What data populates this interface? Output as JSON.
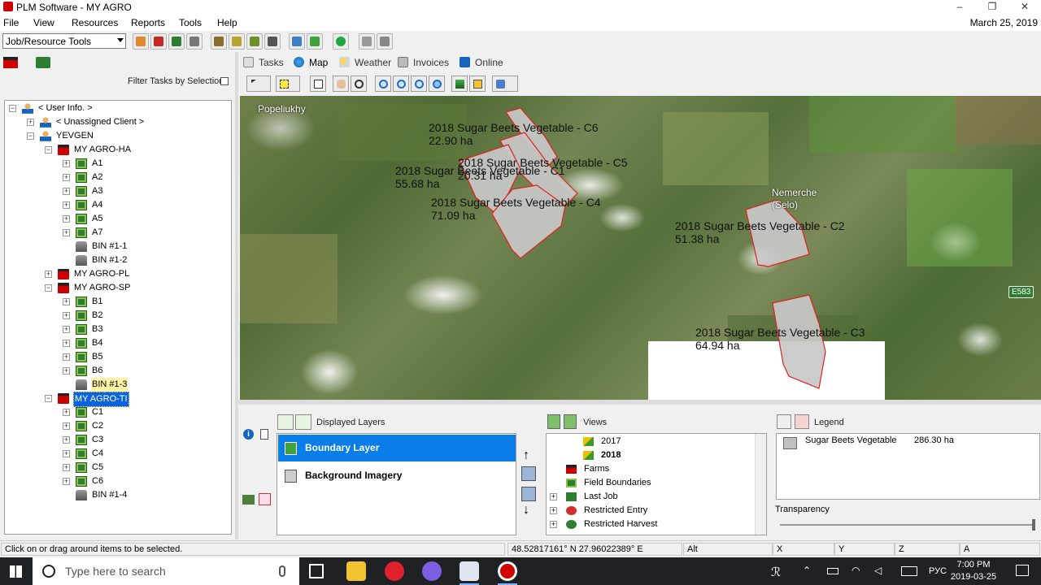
{
  "window": {
    "title": "PLM Software - MY AGRO",
    "minimize": "–",
    "restore": "❐",
    "close": "✕"
  },
  "menu": [
    "File",
    "View",
    "Resources",
    "Reports",
    "Tools",
    "Help"
  ],
  "date": "March 25, 2019",
  "toolbar": {
    "job_select": "Job/Resource Tools"
  },
  "left": {
    "filter_label": "Filter Tasks by Selection"
  },
  "tree": [
    {
      "label": "< User Info. >",
      "icon": "user-icon",
      "level": 0,
      "exp": "−"
    },
    {
      "label": "< Unassigned Client >",
      "icon": "user-icon",
      "level": 1,
      "exp": "+"
    },
    {
      "label": "YEVGEN",
      "icon": "user-icon",
      "level": 1,
      "exp": "−"
    },
    {
      "label": "MY AGRO-HA",
      "icon": "farm-icon",
      "level": 2,
      "exp": "−"
    },
    {
      "label": "A1",
      "icon": "field-icon",
      "level": 3,
      "exp": "+"
    },
    {
      "label": "A2",
      "icon": "field-icon",
      "level": 3,
      "exp": "+"
    },
    {
      "label": "A3",
      "icon": "field-icon",
      "level": 3,
      "exp": "+"
    },
    {
      "label": "A4",
      "icon": "field-icon",
      "level": 3,
      "exp": "+"
    },
    {
      "label": "A5",
      "icon": "field-icon",
      "level": 3,
      "exp": "+"
    },
    {
      "label": "A7",
      "icon": "field-icon",
      "level": 3,
      "exp": "+"
    },
    {
      "label": "BIN #1-1",
      "icon": "bin-icon",
      "level": 3,
      "exp": ""
    },
    {
      "label": "BIN #1-2",
      "icon": "bin-icon",
      "level": 3,
      "exp": ""
    },
    {
      "label": "MY AGRO-PL",
      "icon": "farm-icon",
      "level": 2,
      "exp": "+"
    },
    {
      "label": "MY AGRO-SP",
      "icon": "farm-icon",
      "level": 2,
      "exp": "−"
    },
    {
      "label": "B1",
      "icon": "field-icon",
      "level": 3,
      "exp": "+"
    },
    {
      "label": "B2",
      "icon": "field-icon",
      "level": 3,
      "exp": "+"
    },
    {
      "label": "B3",
      "icon": "field-icon",
      "level": 3,
      "exp": "+"
    },
    {
      "label": "B4",
      "icon": "field-icon",
      "level": 3,
      "exp": "+"
    },
    {
      "label": "B5",
      "icon": "field-icon",
      "level": 3,
      "exp": "+"
    },
    {
      "label": "B6",
      "icon": "field-icon",
      "level": 3,
      "exp": "+"
    },
    {
      "label": "BIN #1-3",
      "icon": "bin-icon",
      "level": 3,
      "exp": "",
      "state": "hl"
    },
    {
      "label": "MY AGRO-TI",
      "icon": "farm-icon",
      "level": 2,
      "exp": "−",
      "state": "sel"
    },
    {
      "label": "C1",
      "icon": "field-icon",
      "level": 3,
      "exp": "+"
    },
    {
      "label": "C2",
      "icon": "field-icon",
      "level": 3,
      "exp": "+"
    },
    {
      "label": "C3",
      "icon": "field-icon",
      "level": 3,
      "exp": "+"
    },
    {
      "label": "C4",
      "icon": "field-icon",
      "level": 3,
      "exp": "+"
    },
    {
      "label": "C5",
      "icon": "field-icon",
      "level": 3,
      "exp": "+"
    },
    {
      "label": "C6",
      "icon": "field-icon",
      "level": 3,
      "exp": "+"
    },
    {
      "label": "BIN #1-4",
      "icon": "bin-icon",
      "level": 3,
      "exp": ""
    }
  ],
  "tabs": [
    "Tasks",
    "Map",
    "Weather",
    "Invoices",
    "Online"
  ],
  "active_tab": "Map",
  "map": {
    "towns": [
      "Popeliukhy",
      "Nemerche",
      "(Selo)"
    ],
    "road_badge": "E583",
    "fields": [
      {
        "name": "2018 Sugar Beets Vegetable - C6",
        "area": "22.90 ha"
      },
      {
        "name": "2018 Sugar Beets Vegetable - C5",
        "area": "20.31 ha"
      },
      {
        "name": "2018 Sugar Beets Vegetable - C1",
        "area": "55.68 ha"
      },
      {
        "name": "2018 Sugar Beets Vegetable - C4",
        "area": "71.09 ha"
      },
      {
        "name": "2018 Sugar Beets Vegetable - C2",
        "area": "51.38 ha"
      },
      {
        "name": "2018 Sugar Beets Vegetable - C3",
        "area": "64.94 ha"
      }
    ]
  },
  "layers": {
    "header": "Displayed Layers",
    "items": [
      "Boundary Layer",
      "Background Imagery"
    ],
    "selected": "Boundary Layer"
  },
  "views": {
    "header": "Views",
    "items": [
      {
        "label": "2017",
        "icon": "crop-icon",
        "bold": false,
        "exp": ""
      },
      {
        "label": "2018",
        "icon": "crop-icon",
        "bold": true,
        "exp": ""
      },
      {
        "label": "Farms",
        "icon": "farm-icon",
        "bold": false,
        "exp": ""
      },
      {
        "label": "Field Boundaries",
        "icon": "field-icon",
        "bold": false,
        "exp": ""
      },
      {
        "label": "Last Job",
        "icon": "job-icon",
        "bold": false,
        "exp": "+"
      },
      {
        "label": "Restricted Entry",
        "icon": "restricted-icon",
        "bold": false,
        "exp": "+"
      },
      {
        "label": "Restricted Harvest",
        "icon": "restricted-icon",
        "bold": false,
        "exp": "+"
      }
    ]
  },
  "legend": {
    "header": "Legend",
    "items": [
      {
        "label": "Sugar Beets Vegetable",
        "value": "286.30 ha",
        "color": "#c0c0c0"
      }
    ],
    "transparency_label": "Transparency"
  },
  "status": {
    "hint": "Click on or drag around items to be selected.",
    "coords": "48.52817161° N   27.96022389° E",
    "alt": "Alt",
    "x": "X",
    "y": "Y",
    "z": "Z",
    "a": "A"
  },
  "taskbar": {
    "search_placeholder": "Type here to search",
    "time": "7:00 PM",
    "date": "2019-03-25",
    "lang": "РУС"
  }
}
